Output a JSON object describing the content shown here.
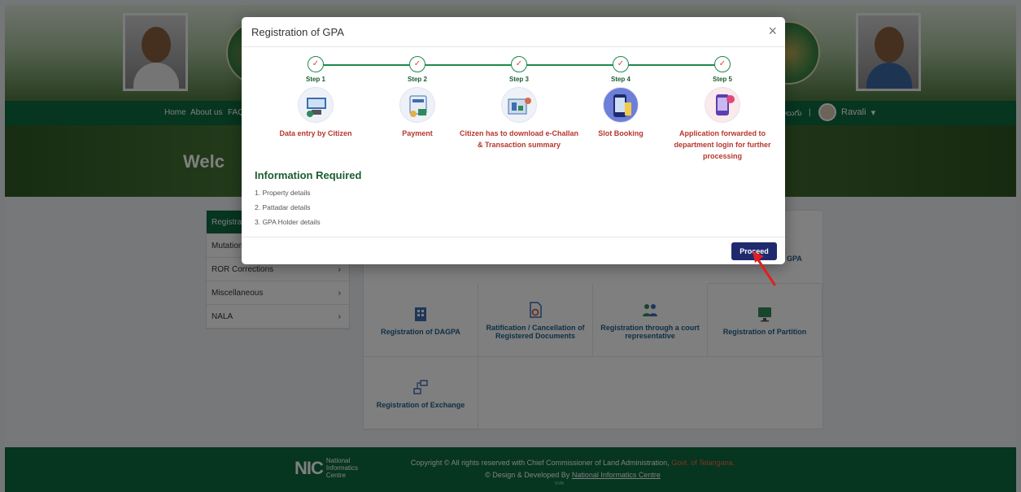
{
  "navbar": {
    "items": [
      "Home",
      "About us",
      "FAQ"
    ],
    "lang": "తెలుగు",
    "user": "Ravali"
  },
  "banner": {
    "title_fragment": "Welc"
  },
  "sidebar": {
    "items": [
      {
        "label": "Registra",
        "arrow": ""
      },
      {
        "label": "Mutation",
        "arrow": ""
      },
      {
        "label": "ROR Corrections",
        "arrow": "›"
      },
      {
        "label": "Miscellaneous",
        "arrow": "›"
      },
      {
        "label": "NALA",
        "arrow": "›"
      }
    ]
  },
  "grid": {
    "partial_tile": "GPA",
    "tiles": [
      {
        "label": "Registration of DAGPA",
        "icon": "building-icon"
      },
      {
        "label": "Ratification / Cancellation of Registered Documents",
        "icon": "document-cancel-icon"
      },
      {
        "label": "Registration through a court representative",
        "icon": "people-icon"
      },
      {
        "label": "Registration of Partition",
        "icon": "monitor-grid-icon"
      },
      {
        "label": "Registration of Exchange",
        "icon": "exchange-icon"
      }
    ]
  },
  "footer": {
    "nic_mark": "NIC",
    "nic_lines": [
      "National",
      "Informatics",
      "Centre"
    ],
    "copyright": "Copyright © All rights reserved with Chief Commissioner of Land Administration,",
    "govt": "Govt. of Telangana.",
    "design_prefix": "© Design & Developed By",
    "design_link": "National Informatics Centre",
    "tiny": "SVM"
  },
  "modal": {
    "title": "Registration of GPA",
    "close": "×",
    "steps": [
      {
        "num": "Step 1",
        "label": "Data entry by Citizen",
        "icon": "data-entry-icon"
      },
      {
        "num": "Step 2",
        "label": "Payment",
        "icon": "payment-icon"
      },
      {
        "num": "Step 3",
        "label": "Citizen has to download e-Challan & Transaction summary",
        "icon": "download-icon"
      },
      {
        "num": "Step 4",
        "label": "Slot Booking",
        "icon": "slot-booking-icon"
      },
      {
        "num": "Step 5",
        "label": "Application forwarded to department login for further processing",
        "icon": "forward-icon"
      }
    ],
    "check": "✓",
    "info_title": "Information Required",
    "info_items": [
      "1. Property details",
      "2. Pattadar details",
      "3. GPA Holder details"
    ],
    "proceed": "Proceed"
  },
  "colors": {
    "green": "#0d6b40",
    "step_green": "#1a5e2f",
    "step_label": "#b7362c",
    "proceed_bg": "#1f2a6e",
    "govt_text": "#ff6a3d",
    "arrow": "#e02020"
  }
}
